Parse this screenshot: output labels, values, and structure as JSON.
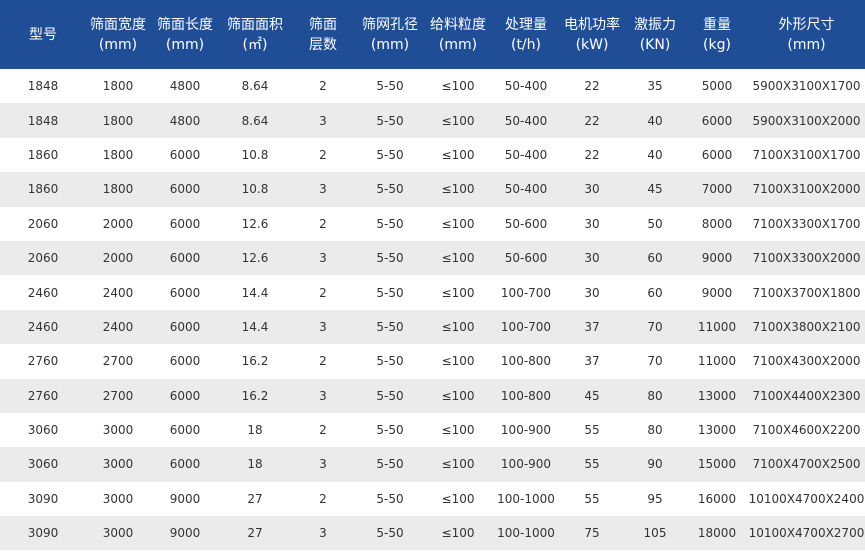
{
  "table": {
    "headers": [
      {
        "l1": "型号",
        "l2": ""
      },
      {
        "l1": "筛面宽度",
        "l2": "(mm)"
      },
      {
        "l1": "筛面长度",
        "l2": "(mm)"
      },
      {
        "l1": "筛面面积",
        "l2": "(㎡)"
      },
      {
        "l1": "筛面",
        "l2": "层数"
      },
      {
        "l1": "筛网孔径",
        "l2": "(mm)"
      },
      {
        "l1": "给料粒度",
        "l2": "(mm)"
      },
      {
        "l1": "处理量",
        "l2": "(t/h)"
      },
      {
        "l1": "电机功率",
        "l2": "(kW)"
      },
      {
        "l1": "激振力",
        "l2": "(KN)"
      },
      {
        "l1": "重量",
        "l2": "(kg)"
      },
      {
        "l1": "外形尺寸",
        "l2": "(mm)"
      }
    ],
    "rows": [
      [
        "1848",
        "1800",
        "4800",
        "8.64",
        "2",
        "5-50",
        "≤100",
        "50-400",
        "22",
        "35",
        "5000",
        "5900X3100X1700"
      ],
      [
        "1848",
        "1800",
        "4800",
        "8.64",
        "3",
        "5-50",
        "≤100",
        "50-400",
        "22",
        "40",
        "6000",
        "5900X3100X2000"
      ],
      [
        "1860",
        "1800",
        "6000",
        "10.8",
        "2",
        "5-50",
        "≤100",
        "50-400",
        "22",
        "40",
        "6000",
        "7100X3100X1700"
      ],
      [
        "1860",
        "1800",
        "6000",
        "10.8",
        "3",
        "5-50",
        "≤100",
        "50-400",
        "30",
        "45",
        "7000",
        "7100X3100X2000"
      ],
      [
        "2060",
        "2000",
        "6000",
        "12.6",
        "2",
        "5-50",
        "≤100",
        "50-600",
        "30",
        "50",
        "8000",
        "7100X3300X1700"
      ],
      [
        "2060",
        "2000",
        "6000",
        "12.6",
        "3",
        "5-50",
        "≤100",
        "50-600",
        "30",
        "60",
        "9000",
        "7100X3300X2000"
      ],
      [
        "2460",
        "2400",
        "6000",
        "14.4",
        "2",
        "5-50",
        "≤100",
        "100-700",
        "30",
        "60",
        "9000",
        "7100X3700X1800"
      ],
      [
        "2460",
        "2400",
        "6000",
        "14.4",
        "3",
        "5-50",
        "≤100",
        "100-700",
        "37",
        "70",
        "11000",
        "7100X3800X2100"
      ],
      [
        "2760",
        "2700",
        "6000",
        "16.2",
        "2",
        "5-50",
        "≤100",
        "100-800",
        "37",
        "70",
        "11000",
        "7100X4300X2000"
      ],
      [
        "2760",
        "2700",
        "6000",
        "16.2",
        "3",
        "5-50",
        "≤100",
        "100-800",
        "45",
        "80",
        "13000",
        "7100X4400X2300"
      ],
      [
        "3060",
        "3000",
        "6000",
        "18",
        "2",
        "5-50",
        "≤100",
        "100-900",
        "55",
        "80",
        "13000",
        "7100X4600X2200"
      ],
      [
        "3060",
        "3000",
        "6000",
        "18",
        "3",
        "5-50",
        "≤100",
        "100-900",
        "55",
        "90",
        "15000",
        "7100X4700X2500"
      ],
      [
        "3090",
        "3000",
        "9000",
        "27",
        "2",
        "5-50",
        "≤100",
        "100-1000",
        "55",
        "95",
        "16000",
        "10100X4700X2400"
      ],
      [
        "3090",
        "3000",
        "9000",
        "27",
        "3",
        "5-50",
        "≤100",
        "100-1000",
        "75",
        "105",
        "18000",
        "10100X4700X2700"
      ]
    ]
  },
  "colors": {
    "header_bg": "#1f4e96",
    "header_text": "#ffffff",
    "stripe": "#ebebeb",
    "cell_text": "#333333"
  }
}
